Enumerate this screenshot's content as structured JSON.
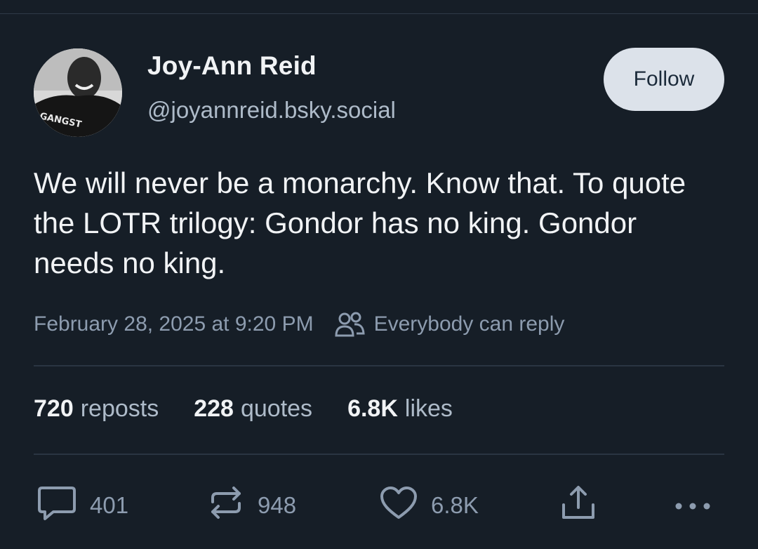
{
  "author": {
    "display_name": "Joy-Ann Reid",
    "handle": "@joyannreid.bsky.social",
    "avatar_shirt_text": "GANGST"
  },
  "follow_label": "Follow",
  "post": {
    "text": "We will never be a monarchy. Know that. To quote the LOTR trilogy: Gondor has no king. Gondor needs no king.",
    "timestamp": "February 28, 2025 at 9:20 PM",
    "reply_setting": "Everybody can reply"
  },
  "stats": {
    "reposts": {
      "count": "720",
      "label": "reposts"
    },
    "quotes": {
      "count": "228",
      "label": "quotes"
    },
    "likes": {
      "count": "6.8K",
      "label": "likes"
    }
  },
  "actions": {
    "reply_count": "401",
    "repost_count": "948",
    "like_count": "6.8K"
  },
  "icons": {
    "reply": "comment-icon",
    "repost": "repost-icon",
    "like": "heart-icon",
    "share": "share-icon",
    "more": "more-icon",
    "reply_setting": "people-icon"
  },
  "colors": {
    "background": "#161e27",
    "muted_text": "#8d9caf",
    "follow_button_bg": "#dce2ea"
  }
}
